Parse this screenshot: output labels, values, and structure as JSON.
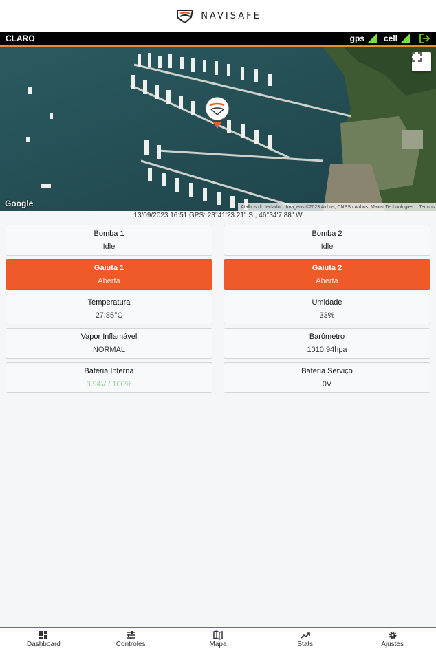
{
  "header": {
    "brand": "NAVISAFE"
  },
  "status": {
    "carrier": "CLARO",
    "gps_label": "gps",
    "cell_label": "cell",
    "signal_color": "#7be038",
    "accent_color": "#f08a2a"
  },
  "map": {
    "google_label": "Google",
    "attribution": [
      "Atalhos do teclado",
      "Imagens ©2023 Airbus, CNES / Airbus, Maxar Technologies",
      "Termos"
    ]
  },
  "gps_line": "13/09/2023 16:51 GPS: 23°41'23.21\" S , 46°34'7.88\" W",
  "cards": [
    {
      "title": "Bomba 1",
      "value": "Idle",
      "state": "normal"
    },
    {
      "title": "Bomba 2",
      "value": "Idle",
      "state": "normal"
    },
    {
      "title": "Gaiuta 1",
      "value": "Aberta",
      "state": "alert"
    },
    {
      "title": "Gaiuta 2",
      "value": "Aberta",
      "state": "alert"
    },
    {
      "title": "Temperatura",
      "value": "27.85°C",
      "state": "normal"
    },
    {
      "title": "Umidade",
      "value": "33%",
      "state": "normal"
    },
    {
      "title": "Vapor Inflamável",
      "value": "NORMAL",
      "state": "normal"
    },
    {
      "title": "Barômetro",
      "value": "1010.94hpa",
      "state": "normal"
    },
    {
      "title": "Bateria Interna",
      "value": "3.94V / 100%",
      "state": "ok"
    },
    {
      "title": "Bateria Serviço",
      "value": "0V",
      "state": "normal"
    }
  ],
  "nav": [
    {
      "label": "Dashboard",
      "icon": "dashboard-icon"
    },
    {
      "label": "Controles",
      "icon": "sliders-icon"
    },
    {
      "label": "Mapa",
      "icon": "map-icon"
    },
    {
      "label": "Stats",
      "icon": "trending-icon"
    },
    {
      "label": "Ajustes",
      "icon": "gear-icon"
    }
  ]
}
